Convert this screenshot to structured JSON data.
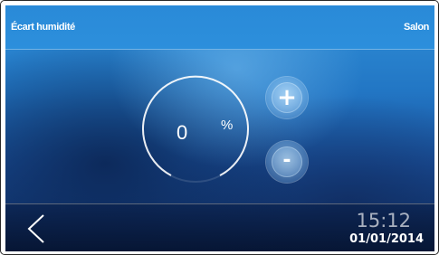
{
  "header": {
    "title": "Écart humidité",
    "room": "Salon"
  },
  "gauge": {
    "value": "0",
    "unit": "%"
  },
  "controls": {
    "plus_label": "+",
    "minus_label": "-"
  },
  "footer": {
    "back_icon": "chevron-left-icon",
    "time": "15:12",
    "date": "01/01/2014"
  }
}
